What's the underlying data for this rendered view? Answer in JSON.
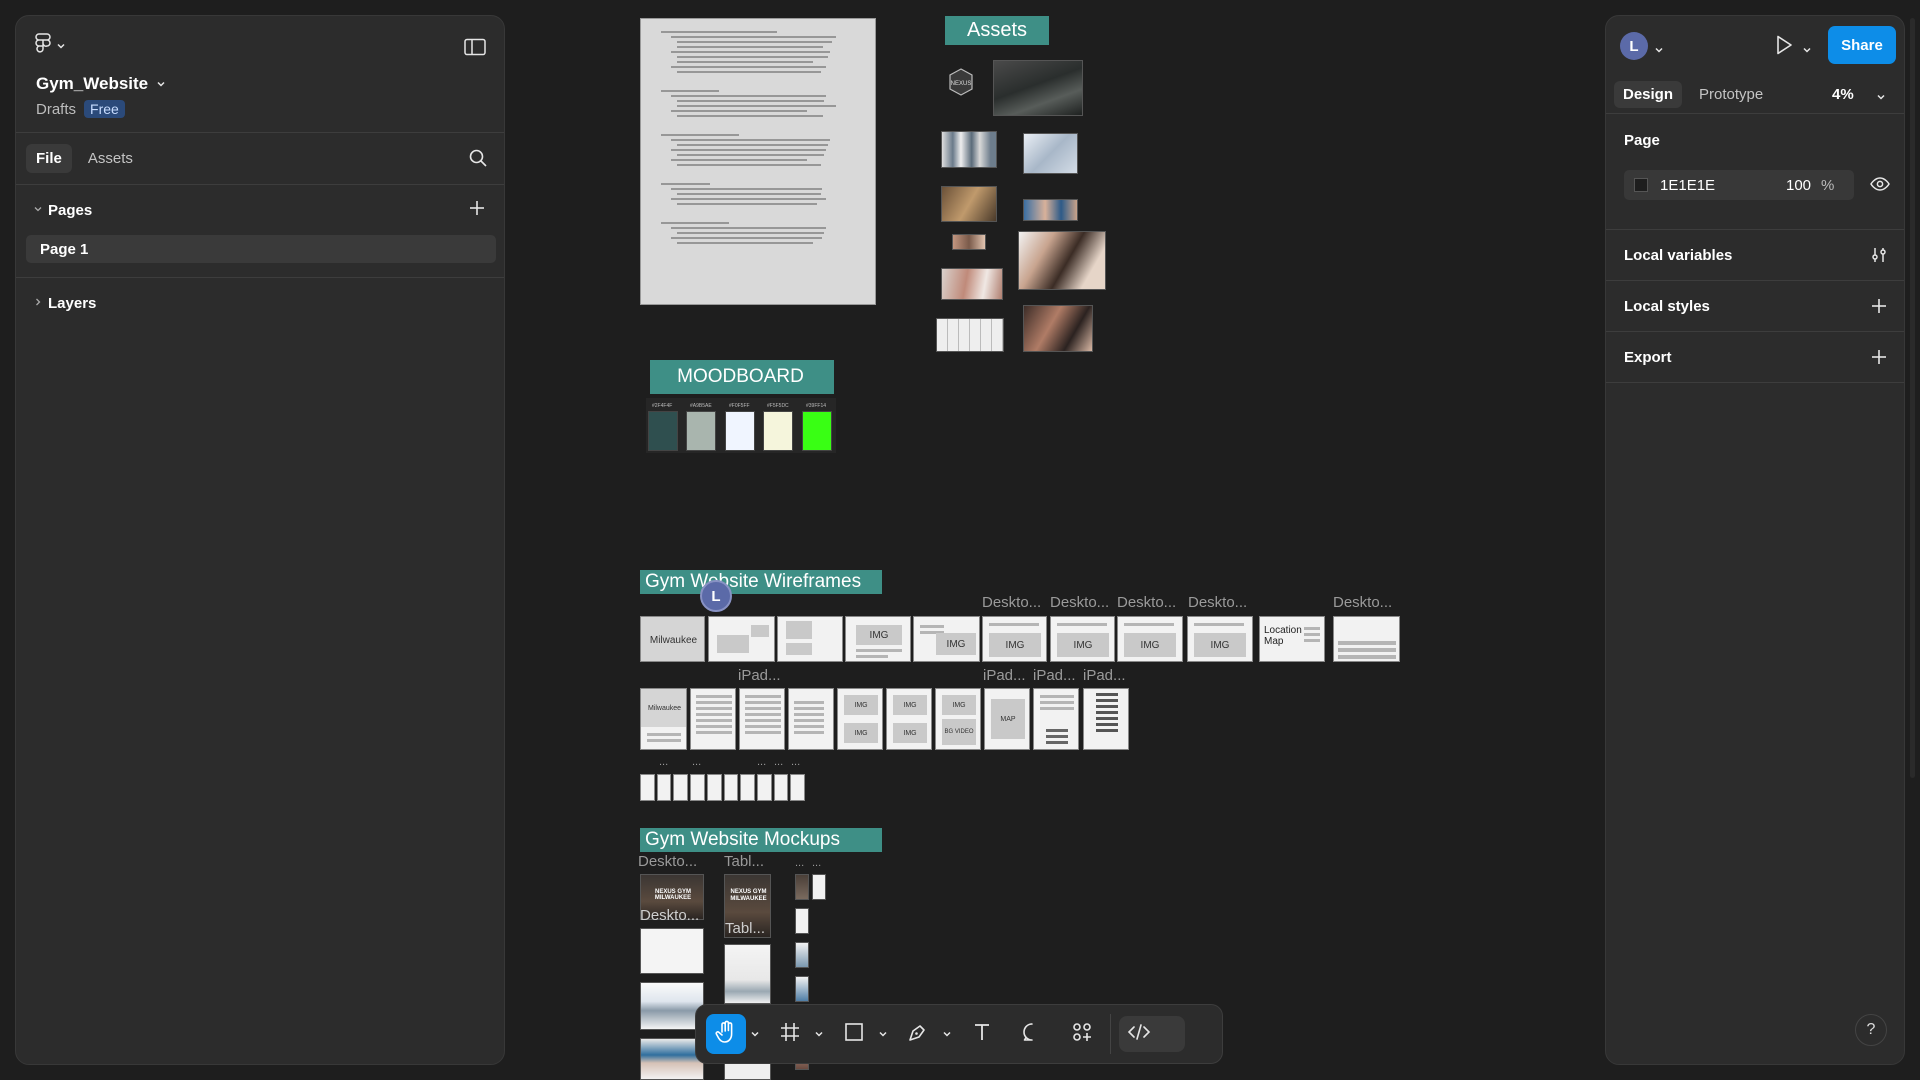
{
  "file": {
    "name": "Gym_Website",
    "location": "Drafts",
    "plan": "Free"
  },
  "left_tabs": {
    "file": "File",
    "assets": "Assets"
  },
  "pages": {
    "header": "Pages",
    "items": [
      "Page 1"
    ]
  },
  "layers": {
    "header": "Layers"
  },
  "right": {
    "avatar_initial": "L",
    "share": "Share",
    "tabs": {
      "design": "Design",
      "prototype": "Prototype"
    },
    "zoom": "4%",
    "page_section": {
      "title": "Page",
      "bg_hex": "1E1E1E",
      "bg_opacity": "100",
      "pct": "%"
    },
    "local_variables": "Local variables",
    "local_styles": "Local styles",
    "export": "Export",
    "help": "?"
  },
  "canvas": {
    "assets_label": "Assets",
    "moodboard_label": "MOODBOARD",
    "moodboard_colors": [
      "#2F4F4F",
      "#A9B5AE",
      "#F0F5FF",
      "#F5F5DC",
      "#39FF14"
    ],
    "moodboard_color_labels": [
      "#2F4F4F",
      "#A9B5AE",
      "#F0F5FF",
      "#F5F5DC",
      "#39FF14"
    ],
    "wireframes_label": "Gym Website Wireframes",
    "mockups_label": "Gym Website Mockups",
    "collab_initial": "L",
    "wireframe_desktop_names": [
      "Deskto...",
      "Deskto...",
      "Deskto...",
      "Deskto...",
      "Deskto..."
    ],
    "wireframe_ipad_names": [
      "iPad...",
      "iPad...",
      "iPad...",
      "iPad..."
    ],
    "wireframe_mobile_names": [
      "...",
      "...",
      "...",
      "...",
      "..."
    ],
    "wf_texts": {
      "milwaukee": "Milwaukee",
      "img": "IMG",
      "location_map": "Location Map",
      "map": "MAP",
      "bg_video": "BG VIDEO"
    },
    "mockup_names": {
      "desktop": "Deskto...",
      "tablet": "Tabl...",
      "mobile_a": "...",
      "mobile_b": "...",
      "desktop2": "Deskto...",
      "tablet2": "Tabl..."
    },
    "mockup_hero": {
      "desktop": "NEXUS GYM MILWAUKEE",
      "tablet": "NEXUS GYM MILWAUKEE"
    }
  }
}
